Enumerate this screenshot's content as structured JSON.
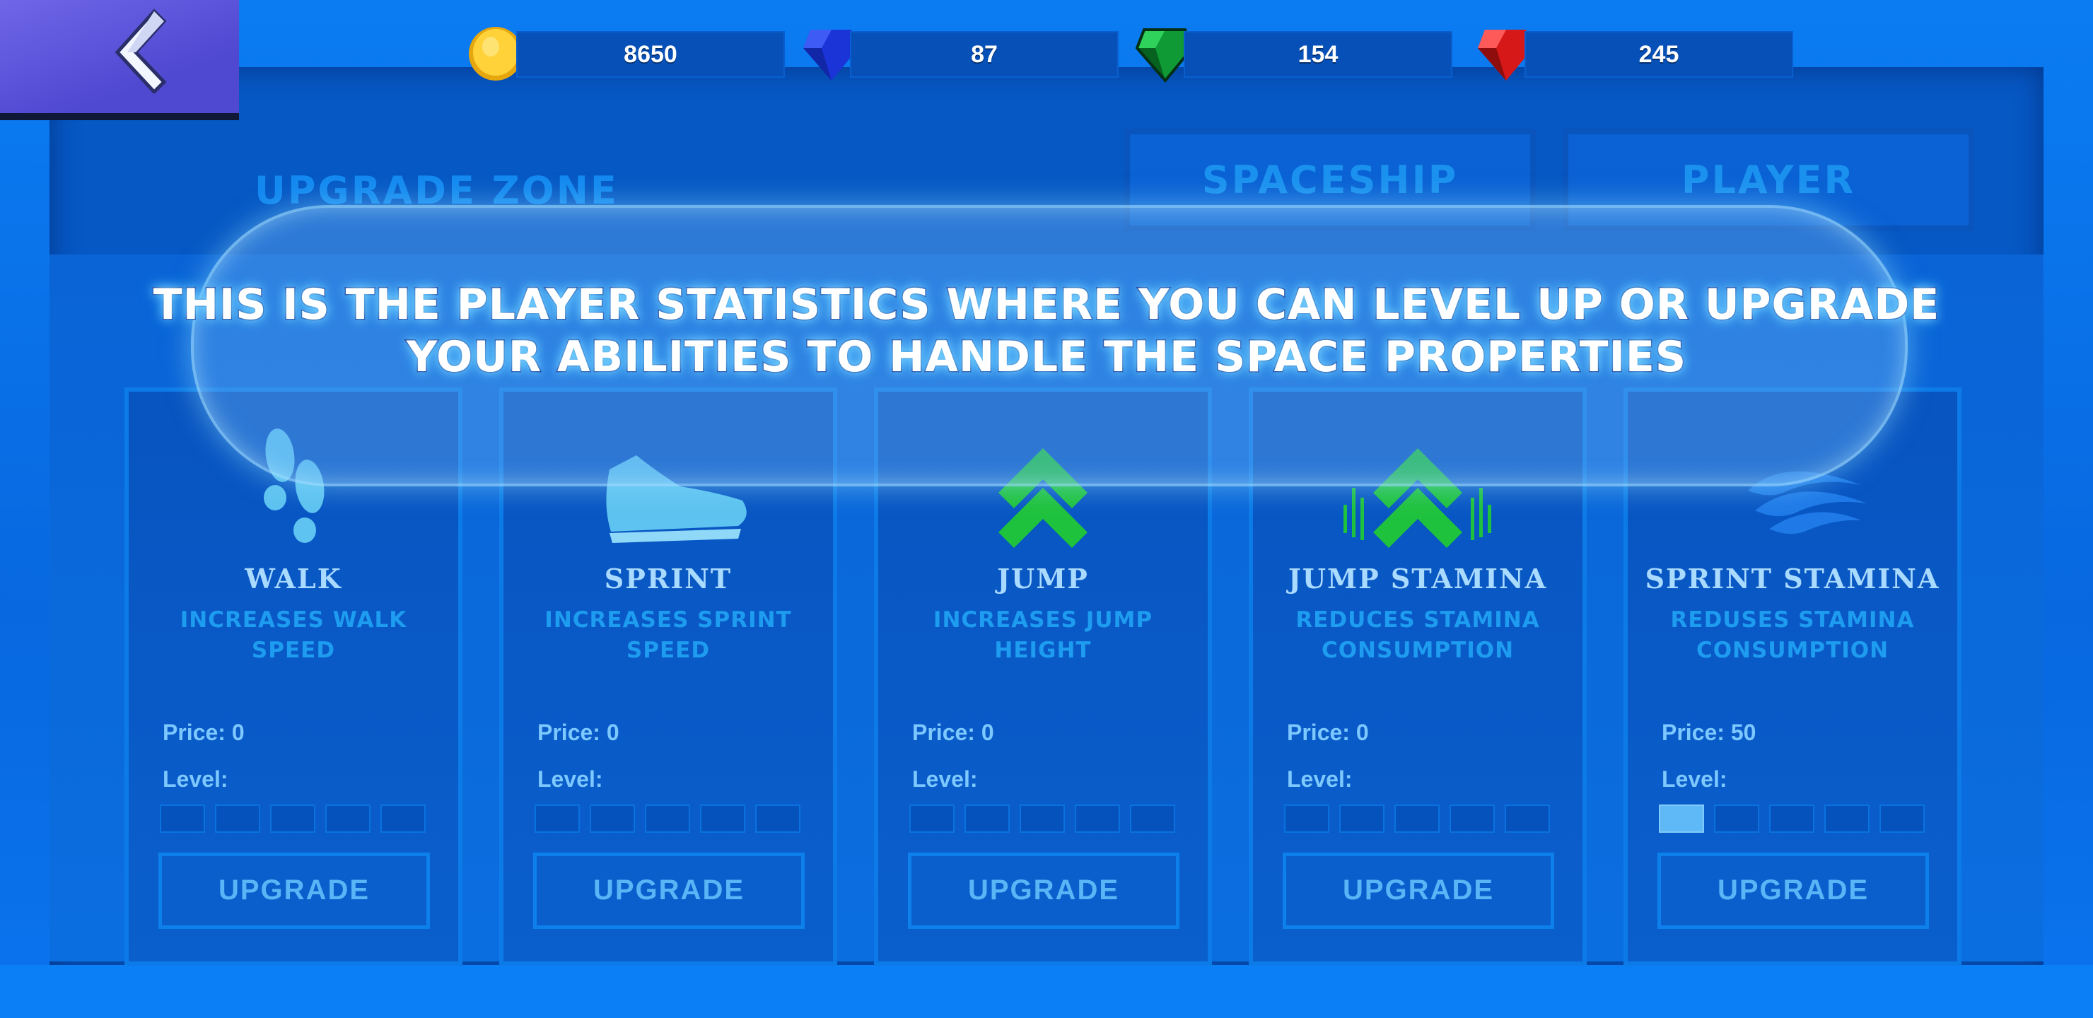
{
  "currencies": [
    {
      "name": "coins",
      "value": "8650",
      "icon": "gold-coin-icon",
      "color": "#f4c21a"
    },
    {
      "name": "blue-gems",
      "value": "87",
      "icon": "blue-gem-icon",
      "color": "#1f3fe6"
    },
    {
      "name": "green-gems",
      "value": "154",
      "icon": "green-gem-icon",
      "color": "#14a33c"
    },
    {
      "name": "red-gems",
      "value": "245",
      "icon": "red-gem-icon",
      "color": "#e21d1d"
    }
  ],
  "header": {
    "title": "UPGRADE ZONE",
    "tabs": [
      {
        "label": "SPACESHIP"
      },
      {
        "label": "PLAYER"
      }
    ]
  },
  "tutorial": {
    "line1": "THIS IS THE PLAYER STATISTICS WHERE YOU CAN LEVEL UP OR UPGRADE",
    "line2": "YOUR ABILITIES TO HANDLE THE SPACE PROPERTIES"
  },
  "cards": [
    {
      "icon": "footprints-icon",
      "title": "WALK",
      "desc1": "INCREASES WALK",
      "desc2": "SPEED",
      "price": "Price: 0",
      "level_label": "Level:",
      "level": 0,
      "button": "UPGRADE"
    },
    {
      "icon": "sneaker-icon",
      "title": "SPRINT",
      "desc1": "INCREASES SPRINT",
      "desc2": "SPEED",
      "price": "Price: 0",
      "level_label": "Level:",
      "level": 0,
      "button": "UPGRADE"
    },
    {
      "icon": "double-chevron-up-icon",
      "title": "JUMP",
      "desc1": "INCREASES JUMP",
      "desc2": "HEIGHT",
      "price": "Price: 0",
      "level_label": "Level:",
      "level": 0,
      "button": "UPGRADE"
    },
    {
      "icon": "chevron-up-stamina-icon",
      "title": "JUMP STAMINA",
      "desc1": "REDUCES STAMINA",
      "desc2": "CONSUMPTION",
      "price": "Price: 0",
      "level_label": "Level:",
      "level": 0,
      "button": "UPGRADE"
    },
    {
      "icon": "wind-waves-icon",
      "title": "SPRINT STAMINA",
      "desc1": "REDUSES STAMINA",
      "desc2": "CONSUMPTION",
      "price": "Price: 50",
      "level_label": "Level:",
      "level": 1,
      "button": "UPGRADE"
    }
  ],
  "max_level": 5
}
